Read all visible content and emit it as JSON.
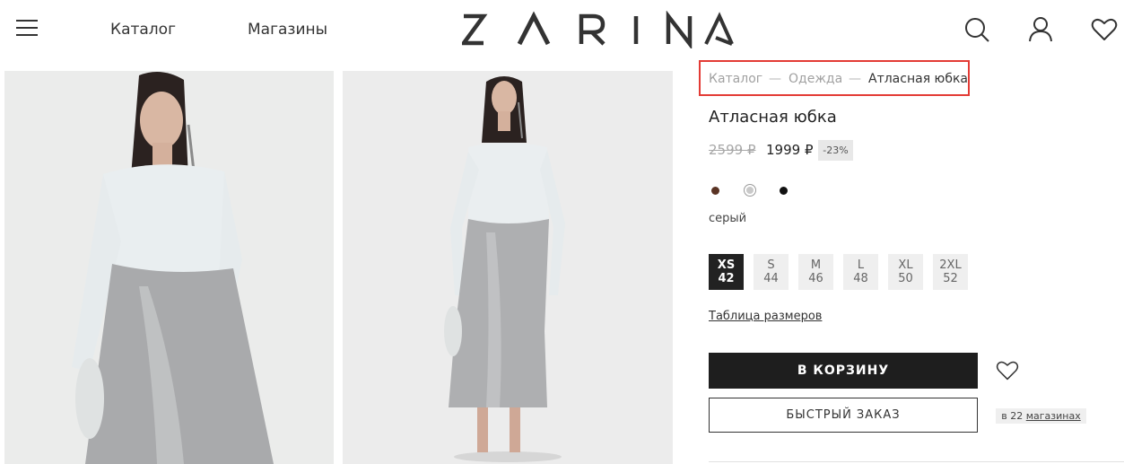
{
  "header": {
    "nav": [
      "Каталог",
      "Магазины"
    ],
    "logo_text": "ZARINA",
    "icons": [
      "menu-icon",
      "search-icon",
      "user-icon",
      "heart-icon"
    ]
  },
  "breadcrumb": {
    "items": [
      "Каталог",
      "Одежда",
      "Атласная юбка"
    ],
    "separator": "—"
  },
  "product": {
    "title": "Атласная юбка",
    "old_price": "2599 ₽",
    "price": "1999 ₽",
    "discount": "-23%",
    "colors": [
      {
        "name": "brown",
        "hex": "#5a3324"
      },
      {
        "name": "grey",
        "hex": "#c9c9c9"
      },
      {
        "name": "black",
        "hex": "#111111"
      }
    ],
    "selected_color": "серый",
    "sizes": [
      {
        "label": "XS",
        "num": "42",
        "selected": true
      },
      {
        "label": "S",
        "num": "44"
      },
      {
        "label": "M",
        "num": "46"
      },
      {
        "label": "L",
        "num": "48"
      },
      {
        "label": "XL",
        "num": "50"
      },
      {
        "label": "2XL",
        "num": "52"
      }
    ],
    "size_table_link": "Таблица размеров",
    "add_to_cart": "В КОРЗИНУ",
    "quick_order": "БЫСТРЫЙ ЗАКАЗ",
    "stores_prefix": "в 22",
    "stores_link": "магазинах"
  },
  "colors": {
    "accent_highlight": "#e33b35",
    "button_dark": "#1e1e1e"
  }
}
